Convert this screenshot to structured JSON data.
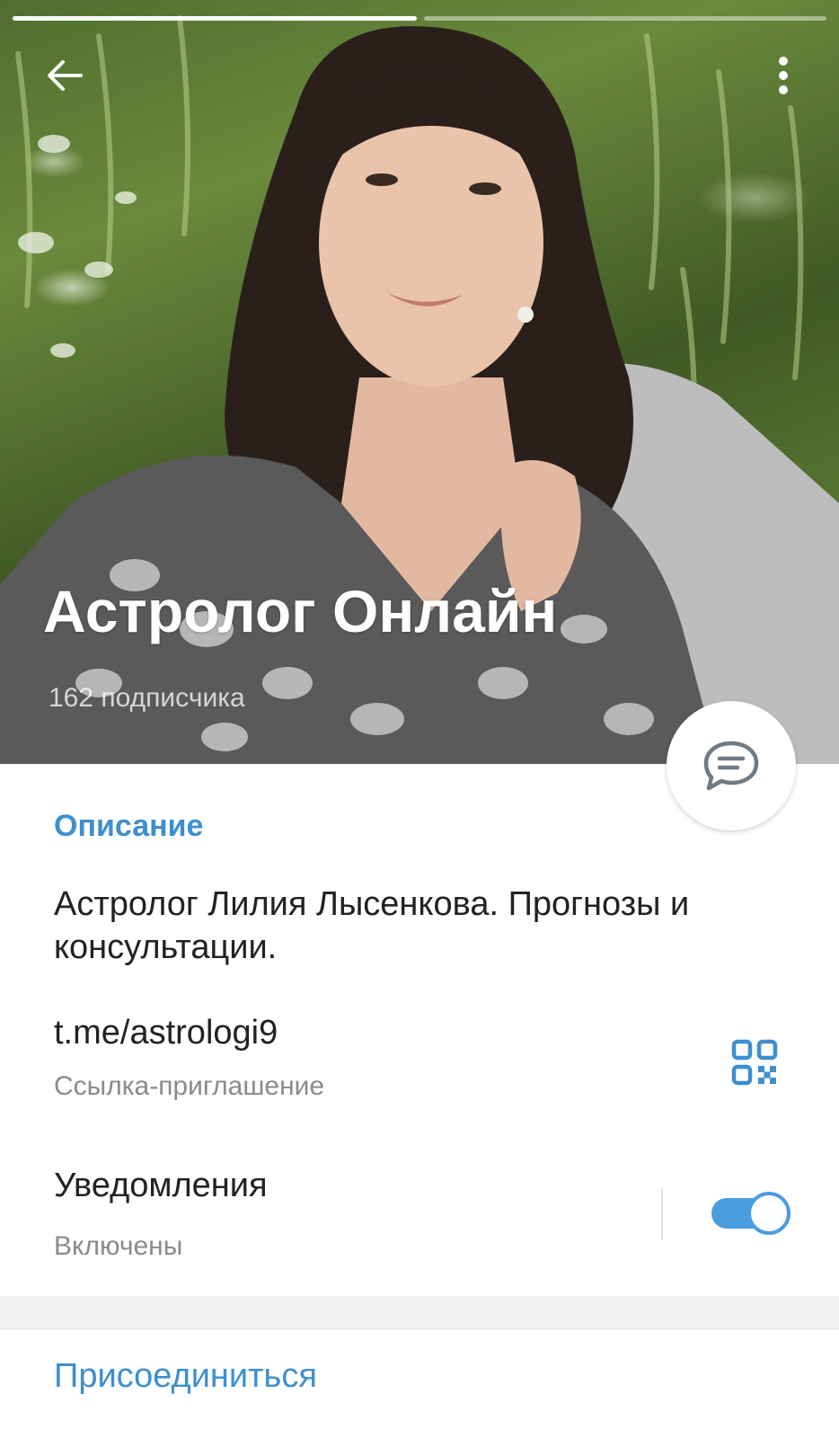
{
  "header": {
    "title": "Астролог Онлайн",
    "subscribers": "162 подписчика",
    "back_icon": "arrow-left-icon",
    "menu_icon": "more-vertical-icon",
    "chat_icon": "chat-bubble-icon"
  },
  "description": {
    "label": "Описание",
    "text": "Астролог Лилия Лысенкова. Прогнозы и консультации."
  },
  "invite_link": {
    "url": "t.me/astrologi9",
    "caption": "Ссылка-приглашение",
    "icon": "qr-code-icon"
  },
  "notifications": {
    "title": "Уведомления",
    "status": "Включены",
    "enabled": true
  },
  "footer": {
    "join_label": "Присоединиться"
  },
  "colors": {
    "accent": "#3d8fd0",
    "toggle": "#4a9de0",
    "text_primary": "#222222",
    "text_secondary": "#8a8a8a"
  }
}
